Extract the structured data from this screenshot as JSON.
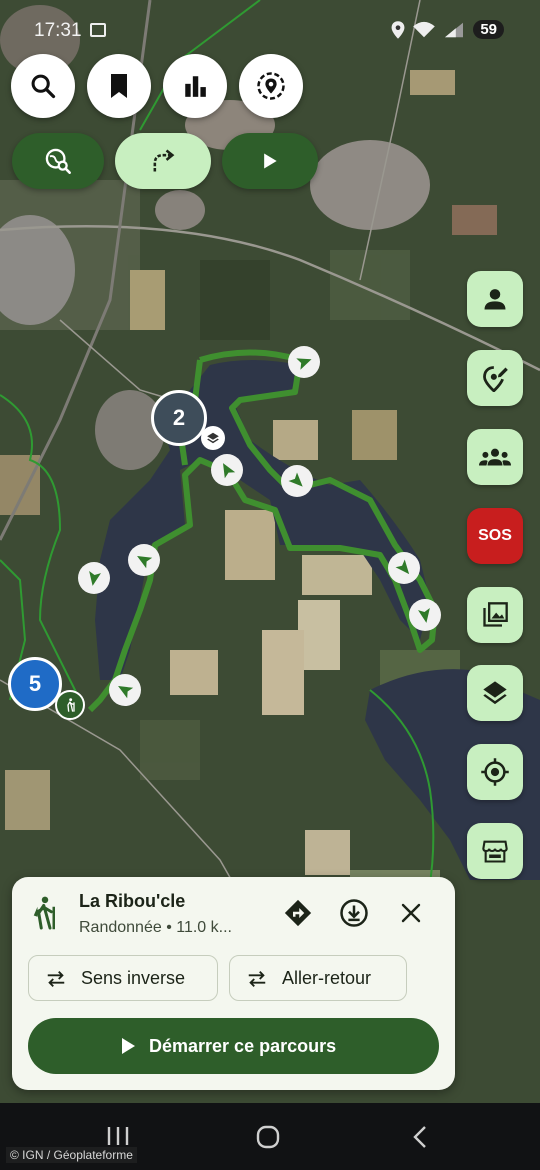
{
  "statusbar": {
    "time": "17:31",
    "battery": "59"
  },
  "top_buttons": {
    "search_icon": "search-icon",
    "bookmark_icon": "bookmark-icon",
    "stats_icon": "bar-chart-icon",
    "location_icon": "location-target-icon"
  },
  "action_pills": {
    "explore_icon": "map-search-icon",
    "route_icon": "route-turn-icon",
    "play_icon": "play-icon"
  },
  "side_buttons": {
    "sos_label": "SOS",
    "icons": [
      "person-icon",
      "edit-location-icon",
      "group-icon",
      "gallery-icon",
      "layers-icon",
      "gps-target-icon",
      "store-icon"
    ]
  },
  "map": {
    "cluster_2": "2",
    "cluster_5": "5"
  },
  "route_card": {
    "title": "La Ribou'cle",
    "subtitle": "Randonnée • 11.0 k...",
    "reverse_label": "Sens inverse",
    "round_trip_label": "Aller-retour",
    "start_label": "Démarrer ce parcours"
  },
  "attribution": "© IGN / Géoplateforme",
  "colors": {
    "accent_dark": "#2e5e2a",
    "accent_light": "#c8efc0",
    "sos": "#c81e1e",
    "route": "#3f8f2f",
    "card_bg": "#f4f7ef"
  }
}
